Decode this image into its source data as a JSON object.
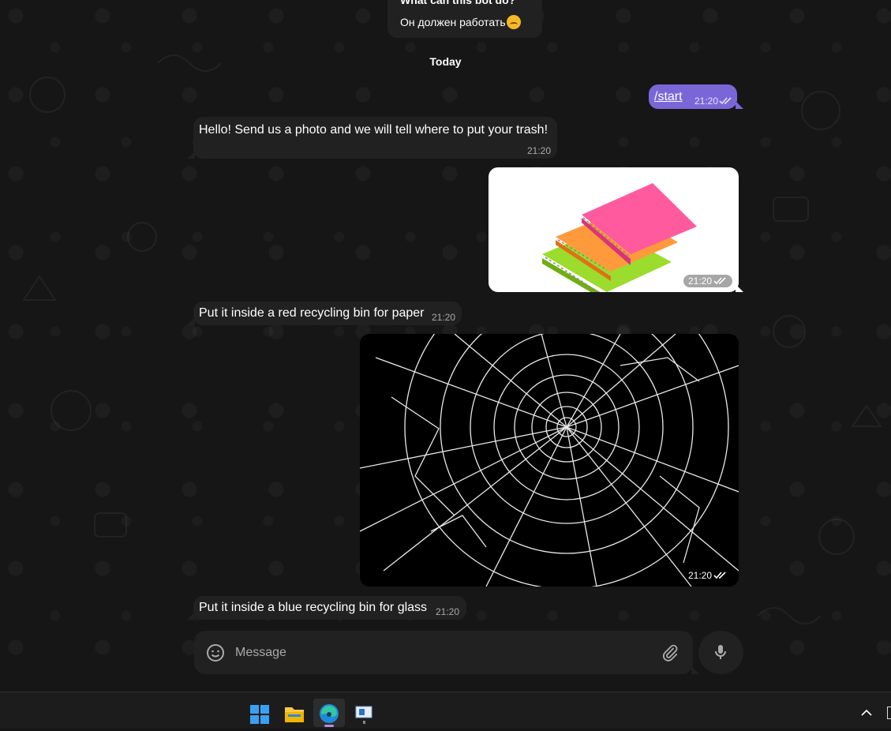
{
  "pinned": {
    "title": "What can this bot do?",
    "text": "Он должен работать"
  },
  "date_separator": "Today",
  "messages": [
    {
      "type": "out-text",
      "text": "/start",
      "time": "21:20"
    },
    {
      "type": "in-text",
      "text": "Hello! Send us a photo and we will tell where to put your trash!",
      "time": "21:20"
    },
    {
      "type": "out-photo",
      "subject": "notebooks",
      "time": "21:20"
    },
    {
      "type": "in-text",
      "text": "Put it inside a red recycling bin for paper",
      "time": "21:20"
    },
    {
      "type": "out-photo",
      "subject": "broken-glass",
      "time": "21:20"
    },
    {
      "type": "in-text",
      "text": "Put it inside a blue recycling bin for glass",
      "time": "21:20"
    }
  ],
  "composer": {
    "placeholder": "Message",
    "emoji_icon": "smile-icon",
    "attach_icon": "paperclip-icon",
    "mic_icon": "microphone-icon"
  },
  "taskbar": {
    "icons": [
      "windows-start-icon",
      "file-explorer-icon",
      "edge-browser-icon",
      "app-window-icon"
    ],
    "tray": [
      "chevron-up-icon"
    ]
  },
  "colors": {
    "accent_out": "#7b66d8",
    "bubble_in": "#212121",
    "background": "#161616"
  }
}
